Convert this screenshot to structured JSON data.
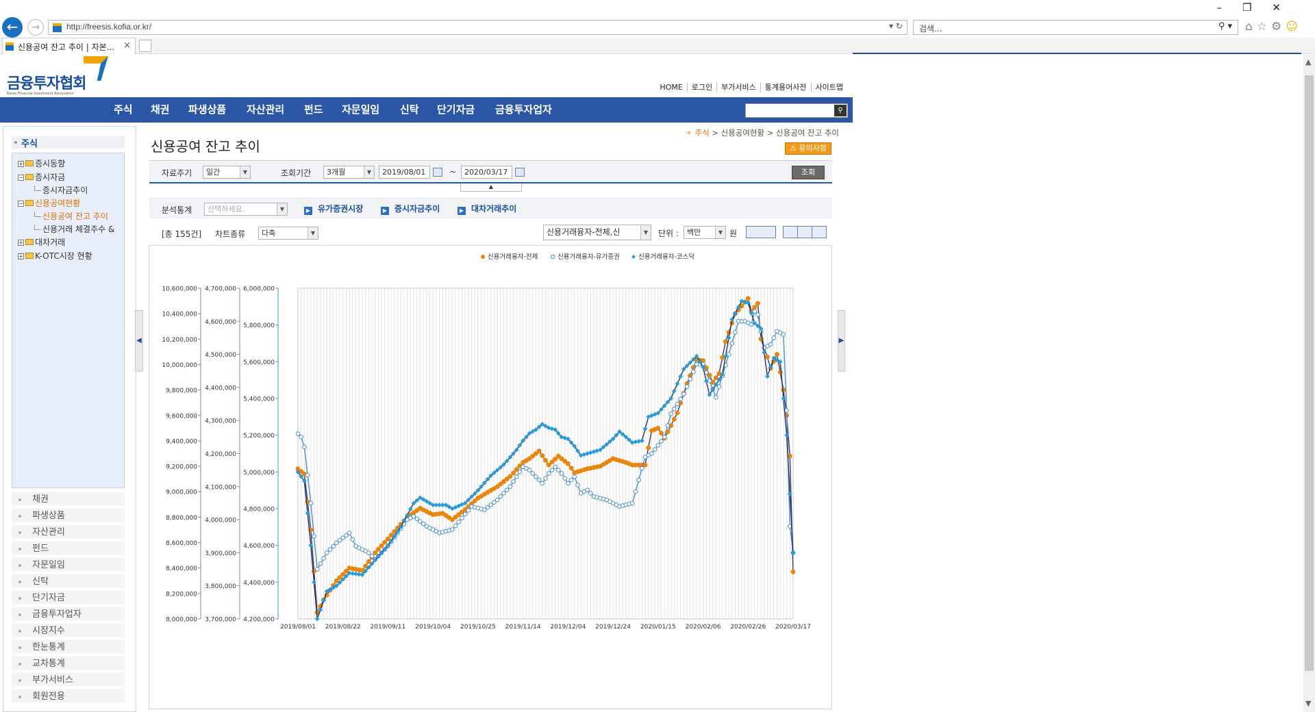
{
  "browser": {
    "url": "http://freesis.kofia.or.kr/",
    "search_placeholder": "검색...",
    "tab_title": "신용공여 잔고 추이 | 자본...",
    "tab_close": "×"
  },
  "site": {
    "logo_text": "금융투자협회",
    "logo_sub": "Korea Financial Investment Association",
    "top_links": [
      "HOME",
      "로그인",
      "부가서비스",
      "통계용어사전",
      "사이트맵"
    ],
    "gnb": [
      "주식",
      "채권",
      "파생상품",
      "자산관리",
      "펀드",
      "자문일임",
      "신탁",
      "단기자금",
      "금융투자업자"
    ]
  },
  "sidebar": {
    "head": "주식",
    "tree": [
      {
        "label": "증시동향",
        "type": "folder",
        "expand": "+"
      },
      {
        "label": "증시자금",
        "type": "folder-open",
        "expand": "−"
      },
      {
        "label": "증시자금추이",
        "type": "doc"
      },
      {
        "label": "신용공여현황",
        "type": "folder-open",
        "expand": "−",
        "active": true
      },
      {
        "label": "신용공여 잔고 추이",
        "type": "doc",
        "active": true
      },
      {
        "label": "신용거래 체결주수 &",
        "type": "doc"
      },
      {
        "label": "대차거래",
        "type": "folder",
        "expand": "+"
      },
      {
        "label": "K-OTC시장 현황",
        "type": "folder",
        "expand": "+"
      }
    ],
    "menus": [
      "채권",
      "파생상품",
      "자산관리",
      "펀드",
      "자문일임",
      "신탁",
      "단기자금",
      "금융투자업자",
      "시장지수",
      "한눈통계",
      "교차통계",
      "부가서비스",
      "회원전용"
    ]
  },
  "content": {
    "title": "신용공여 잔고 추이",
    "breadcrumb": [
      "주식",
      "신용공여현황",
      "신용공여 잔고 추이"
    ],
    "notice_button": "⚠ 유의사항",
    "conditions": {
      "period_label": "자료주기",
      "period_value": "일간",
      "range_label": "조회기간",
      "range_value": "3개월",
      "start_date": "2019/08/01",
      "tilde": "~",
      "end_date": "2020/03/17",
      "query_button": "조회"
    },
    "analysis": {
      "label": "분석통계",
      "placeholder": "선택하세요.",
      "links": [
        "유가증권시장",
        "증시자금추이",
        "대차거래추이"
      ]
    },
    "options": {
      "count": "[총 155건]",
      "chart_type_label": "차트종류",
      "chart_type_value": "다축",
      "series_select": "신용거래융자-전체,신",
      "unit_label": "단위 :",
      "unit_value": "백만",
      "unit_suffix": "원"
    }
  },
  "colors": {
    "orange": "#e8870e",
    "light_blue": "#4a8fc4",
    "blue": "#2b9bd8",
    "navy": "#2b56a6"
  },
  "chart_data": {
    "type": "line",
    "legend": [
      "신용거래융자-전체",
      "신용거래융자-유가증권",
      "신용거래융자-코스닥"
    ],
    "legend_placement": "top-right",
    "grid": true,
    "x_ticks": [
      "2019/08/01",
      "2019/08/22",
      "2019/09/11",
      "2019/10/04",
      "2019/10/25",
      "2019/11/14",
      "2019/12/04",
      "2019/12/24",
      "2020/01/15",
      "2020/02/06",
      "2020/02/26",
      "2020/03/17"
    ],
    "axes": [
      {
        "ticks": [
          "10,600,000",
          "10,400,000",
          "10,200,000",
          "10,000,000",
          "9,800,000",
          "9,600,000",
          "9,400,000",
          "9,200,000",
          "9,000,000",
          "8,800,000",
          "8,600,000",
          "8,400,000",
          "8,200,000",
          "8,000,000"
        ],
        "range": [
          8000000,
          10600000
        ]
      },
      {
        "ticks": [
          "4,700,000",
          "4,600,000",
          "4,500,000",
          "4,400,000",
          "4,300,000",
          "4,200,000",
          "4,100,000",
          "4,000,000",
          "3,900,000",
          "3,800,000",
          "3,700,000"
        ],
        "range": [
          3700000,
          4700000
        ]
      },
      {
        "ticks": [
          "6,000,000",
          "5,800,000",
          "5,600,000",
          "5,400,000",
          "5,200,000",
          "5,000,000",
          "4,800,000",
          "4,600,000",
          "4,400,000",
          "4,200,000"
        ],
        "range": [
          4200000,
          6000000
        ]
      }
    ],
    "points_count": 155,
    "series": [
      {
        "name": "신용거래융자-전체",
        "axis": 0,
        "anchors": [
          [
            0,
            9180000
          ],
          [
            2,
            9140000
          ],
          [
            4,
            8700000
          ],
          [
            6,
            8050000
          ],
          [
            8,
            8150000
          ],
          [
            12,
            8300000
          ],
          [
            16,
            8400000
          ],
          [
            20,
            8380000
          ],
          [
            24,
            8520000
          ],
          [
            28,
            8630000
          ],
          [
            34,
            8800000
          ],
          [
            38,
            8870000
          ],
          [
            42,
            8820000
          ],
          [
            45,
            8830000
          ],
          [
            48,
            8780000
          ],
          [
            52,
            8860000
          ],
          [
            56,
            8950000
          ],
          [
            62,
            9040000
          ],
          [
            66,
            9120000
          ],
          [
            70,
            9230000
          ],
          [
            72,
            9260000
          ],
          [
            75,
            9320000
          ],
          [
            78,
            9210000
          ],
          [
            81,
            9280000
          ],
          [
            84,
            9220000
          ],
          [
            86,
            9150000
          ],
          [
            90,
            9180000
          ],
          [
            94,
            9200000
          ],
          [
            98,
            9260000
          ],
          [
            102,
            9230000
          ],
          [
            104,
            9210000
          ],
          [
            108,
            9210000
          ],
          [
            110,
            9480000
          ],
          [
            112,
            9500000
          ],
          [
            114,
            9420000
          ],
          [
            118,
            9620000
          ],
          [
            121,
            9850000
          ],
          [
            124,
            10040000
          ],
          [
            126,
            10030000
          ],
          [
            129,
            9860000
          ],
          [
            131,
            9930000
          ],
          [
            133,
            10180000
          ],
          [
            136,
            10400000
          ],
          [
            139,
            10490000
          ],
          [
            140,
            10520000
          ],
          [
            141,
            10420000
          ],
          [
            143,
            10480000
          ],
          [
            144,
            10200000
          ],
          [
            146,
            10060000
          ],
          [
            147,
            9970000
          ],
          [
            149,
            10080000
          ],
          [
            151,
            9800000
          ],
          [
            152,
            9600000
          ],
          [
            153,
            9280000
          ],
          [
            154,
            8370000
          ]
        ]
      },
      {
        "name": "신용거래융자-유가증권",
        "axis": 1,
        "anchors": [
          [
            0,
            4260000
          ],
          [
            1,
            4250000
          ],
          [
            2,
            4220000
          ],
          [
            4,
            4050000
          ],
          [
            6,
            3850000
          ],
          [
            9,
            3900000
          ],
          [
            12,
            3930000
          ],
          [
            16,
            3960000
          ],
          [
            18,
            3920000
          ],
          [
            22,
            3900000
          ],
          [
            24,
            3880000
          ],
          [
            28,
            3920000
          ],
          [
            34,
            4000000
          ],
          [
            36,
            4010000
          ],
          [
            40,
            3980000
          ],
          [
            44,
            3960000
          ],
          [
            48,
            3970000
          ],
          [
            54,
            4040000
          ],
          [
            58,
            4030000
          ],
          [
            62,
            4060000
          ],
          [
            66,
            4100000
          ],
          [
            68,
            4130000
          ],
          [
            70,
            4160000
          ],
          [
            72,
            4150000
          ],
          [
            74,
            4130000
          ],
          [
            76,
            4110000
          ],
          [
            78,
            4140000
          ],
          [
            80,
            4160000
          ],
          [
            82,
            4140000
          ],
          [
            84,
            4110000
          ],
          [
            86,
            4130000
          ],
          [
            88,
            4080000
          ],
          [
            90,
            4090000
          ],
          [
            92,
            4070000
          ],
          [
            96,
            4060000
          ],
          [
            100,
            4040000
          ],
          [
            104,
            4050000
          ],
          [
            106,
            4120000
          ],
          [
            108,
            4190000
          ],
          [
            110,
            4200000
          ],
          [
            114,
            4250000
          ],
          [
            116,
            4320000
          ],
          [
            120,
            4380000
          ],
          [
            124,
            4470000
          ],
          [
            126,
            4470000
          ],
          [
            130,
            4370000
          ],
          [
            134,
            4500000
          ],
          [
            137,
            4600000
          ],
          [
            139,
            4600000
          ],
          [
            141,
            4590000
          ],
          [
            142,
            4630000
          ],
          [
            143,
            4620000
          ],
          [
            145,
            4520000
          ],
          [
            147,
            4530000
          ],
          [
            149,
            4570000
          ],
          [
            151,
            4560000
          ],
          [
            152,
            4330000
          ],
          [
            153,
            3980000
          ],
          [
            154,
            3900000
          ]
        ]
      },
      {
        "name": "신용거래융자-코스닥",
        "axis": 2,
        "anchors": [
          [
            0,
            5000000
          ],
          [
            2,
            4950000
          ],
          [
            4,
            4600000
          ],
          [
            6,
            4200000
          ],
          [
            9,
            4350000
          ],
          [
            12,
            4380000
          ],
          [
            16,
            4450000
          ],
          [
            20,
            4440000
          ],
          [
            24,
            4520000
          ],
          [
            28,
            4600000
          ],
          [
            32,
            4700000
          ],
          [
            36,
            4830000
          ],
          [
            38,
            4860000
          ],
          [
            42,
            4820000
          ],
          [
            46,
            4820000
          ],
          [
            48,
            4800000
          ],
          [
            52,
            4830000
          ],
          [
            56,
            4900000
          ],
          [
            60,
            4980000
          ],
          [
            64,
            5040000
          ],
          [
            68,
            5120000
          ],
          [
            70,
            5170000
          ],
          [
            72,
            5210000
          ],
          [
            74,
            5230000
          ],
          [
            76,
            5260000
          ],
          [
            78,
            5240000
          ],
          [
            80,
            5230000
          ],
          [
            82,
            5190000
          ],
          [
            84,
            5180000
          ],
          [
            86,
            5140000
          ],
          [
            88,
            5090000
          ],
          [
            90,
            5100000
          ],
          [
            94,
            5120000
          ],
          [
            98,
            5180000
          ],
          [
            100,
            5220000
          ],
          [
            104,
            5160000
          ],
          [
            107,
            5170000
          ],
          [
            109,
            5300000
          ],
          [
            112,
            5320000
          ],
          [
            116,
            5400000
          ],
          [
            120,
            5560000
          ],
          [
            124,
            5630000
          ],
          [
            126,
            5570000
          ],
          [
            128,
            5420000
          ],
          [
            132,
            5530000
          ],
          [
            135,
            5830000
          ],
          [
            138,
            5930000
          ],
          [
            140,
            5920000
          ],
          [
            142,
            5810000
          ],
          [
            144,
            5780000
          ],
          [
            146,
            5520000
          ],
          [
            148,
            5620000
          ],
          [
            150,
            5600000
          ],
          [
            152,
            5200000
          ],
          [
            154,
            4560000
          ]
        ]
      }
    ]
  }
}
